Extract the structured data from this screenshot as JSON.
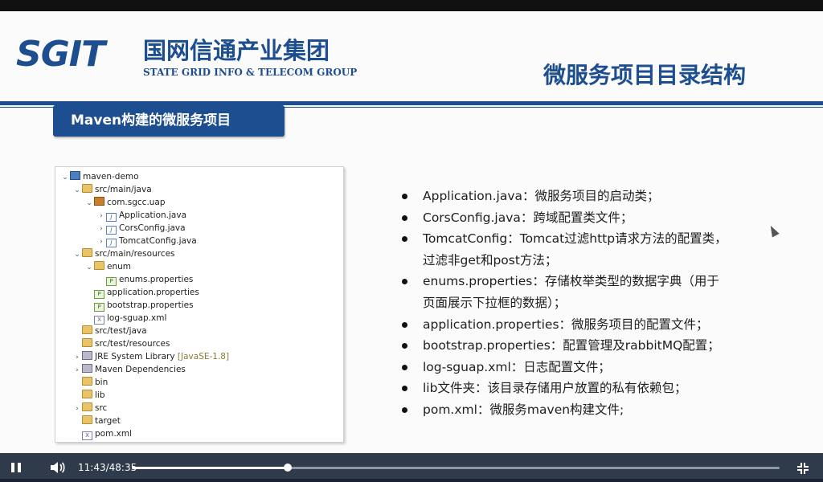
{
  "slide": {
    "logo": {
      "mark": "SGIT",
      "cn": "国网信通产业集团",
      "en": "STATE GRID INFO & TELECOM GROUP"
    },
    "title": "微服务项目目录结构",
    "section_tab": "Maven构建的微服务项目",
    "tree": [
      {
        "depth": 0,
        "arrow": "⌄",
        "icon": "project",
        "label": "maven-demo"
      },
      {
        "depth": 1,
        "arrow": "⌄",
        "icon": "srcfolder",
        "label": "src/main/java"
      },
      {
        "depth": 2,
        "arrow": "⌄",
        "icon": "package",
        "label": "com.sgcc.uap"
      },
      {
        "depth": 3,
        "arrow": "›",
        "icon": "java",
        "label": "Application.java"
      },
      {
        "depth": 3,
        "arrow": "›",
        "icon": "java",
        "label": "CorsConfig.java"
      },
      {
        "depth": 3,
        "arrow": "›",
        "icon": "java",
        "label": "TomcatConfig.java"
      },
      {
        "depth": 1,
        "arrow": "⌄",
        "icon": "srcfolder",
        "label": "src/main/resources"
      },
      {
        "depth": 2,
        "arrow": "⌄",
        "icon": "folder",
        "label": "enum"
      },
      {
        "depth": 3,
        "arrow": "",
        "icon": "prop",
        "label": "enums.properties"
      },
      {
        "depth": 2,
        "arrow": "",
        "icon": "prop",
        "label": "application.properties"
      },
      {
        "depth": 2,
        "arrow": "",
        "icon": "prop",
        "label": "bootstrap.properties"
      },
      {
        "depth": 2,
        "arrow": "",
        "icon": "xml",
        "label": "log-sguap.xml"
      },
      {
        "depth": 1,
        "arrow": "",
        "icon": "srcfolder",
        "label": "src/test/java"
      },
      {
        "depth": 1,
        "arrow": "",
        "icon": "srcfolder",
        "label": "src/test/resources"
      },
      {
        "depth": 1,
        "arrow": "›",
        "icon": "lib",
        "label": "JRE System Library",
        "tag": "[JavaSE-1.8]"
      },
      {
        "depth": 1,
        "arrow": "›",
        "icon": "lib",
        "label": "Maven Dependencies"
      },
      {
        "depth": 1,
        "arrow": "",
        "icon": "folder",
        "label": "bin"
      },
      {
        "depth": 1,
        "arrow": "",
        "icon": "folder",
        "label": "lib"
      },
      {
        "depth": 1,
        "arrow": "›",
        "icon": "folder",
        "label": "src"
      },
      {
        "depth": 1,
        "arrow": "",
        "icon": "folder",
        "label": "target"
      },
      {
        "depth": 1,
        "arrow": "",
        "icon": "xml",
        "label": "pom.xml"
      }
    ],
    "bullets": [
      "Application.java：微服务项目的启动类；",
      "CorsConfig.java：跨域配置类文件；",
      "TomcatConfig：Tomcat过滤http请求方法的配置类，",
      "过滤非get和post方法；",
      "enums.properties：存储枚举类型的数据字典（用于",
      "页面展示下拉框的数据）；",
      "application.properties：微服务项目的配置文件；",
      "bootstrap.properties：配置管理及rabbitMQ配置；",
      "log-sguap.xml：日志配置文件；",
      "lib文件夹：该目录存储用户放置的私有依赖包；",
      "pom.xml：微服务maven构建文件;"
    ],
    "bullet_has_dot": [
      true,
      true,
      true,
      false,
      true,
      false,
      true,
      true,
      true,
      true,
      true
    ]
  },
  "player": {
    "time": "11:43/48:35",
    "progress_fraction": 0.2412,
    "pause_icon": "pause-icon",
    "volume_icon": "volume-icon",
    "fullscreen_icon": "fullscreen-exit-icon"
  },
  "colors": {
    "brand": "#1d4e8f",
    "controls_bg": "#2f3a4a"
  }
}
